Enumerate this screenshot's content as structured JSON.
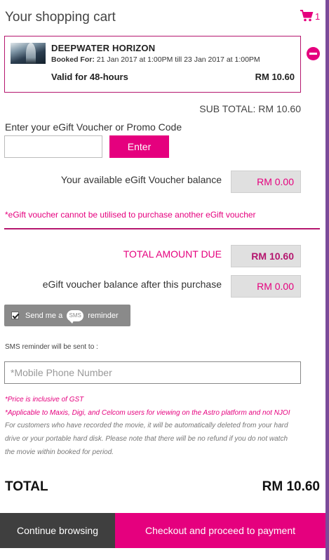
{
  "header": {
    "title": "Your shopping cart",
    "cart_count": "1"
  },
  "cart_item": {
    "title": "DEEPWATER HORIZON",
    "booked_label": "Booked For:",
    "booked_value": "21 Jan 2017 at 1:00PM till 23 Jan 2017 at 1:00PM",
    "validity": "Valid for 48-hours",
    "price": "RM 10.60"
  },
  "subtotal": "SUB TOTAL: RM 10.60",
  "voucher": {
    "label": "Enter your eGift Voucher or Promo Code",
    "value": "",
    "enter_label": "Enter"
  },
  "balance": {
    "label": "Your available eGift Voucher balance",
    "value": "RM 0.00"
  },
  "voucher_note": "*eGift voucher cannot be utilised to purchase another eGift voucher",
  "total_due": {
    "label": "TOTAL AMOUNT DUE",
    "value": "RM 10.60"
  },
  "balance_after": {
    "label": "eGift voucher balance after this purchase",
    "value": "RM 0.00"
  },
  "sms": {
    "prefix": "Send me a",
    "icon_text": "SMS",
    "suffix": "reminder",
    "checked": true,
    "sent_to_label": "SMS reminder will be sent to :",
    "phone_placeholder": "*Mobile Phone Number"
  },
  "notes": [
    "*Price is inclusive of GST",
    "*Applicable to Maxis, Digi, and Celcom users for viewing on the Astro platform and not NJOI",
    "For customers who have recorded the movie, it will be automatically deleted from your hard",
    "drive or your portable hard disk. Please note that there will be no refund if you do not watch",
    "the movie within booked for period."
  ],
  "total": {
    "label": "TOTAL",
    "value": "RM 10.60"
  },
  "footer": {
    "continue_label": "Continue browsing",
    "checkout_label": "Checkout and proceed to payment"
  },
  "colors": {
    "accent": "#e5007e",
    "accent_dark": "#b5176f",
    "side_bar": "#7b4b9a",
    "dark_button": "#3f3f3f"
  },
  "icons": [
    "cart-icon",
    "remove-icon",
    "checkbox-icon",
    "sms-icon",
    "movie-thumbnail"
  ]
}
